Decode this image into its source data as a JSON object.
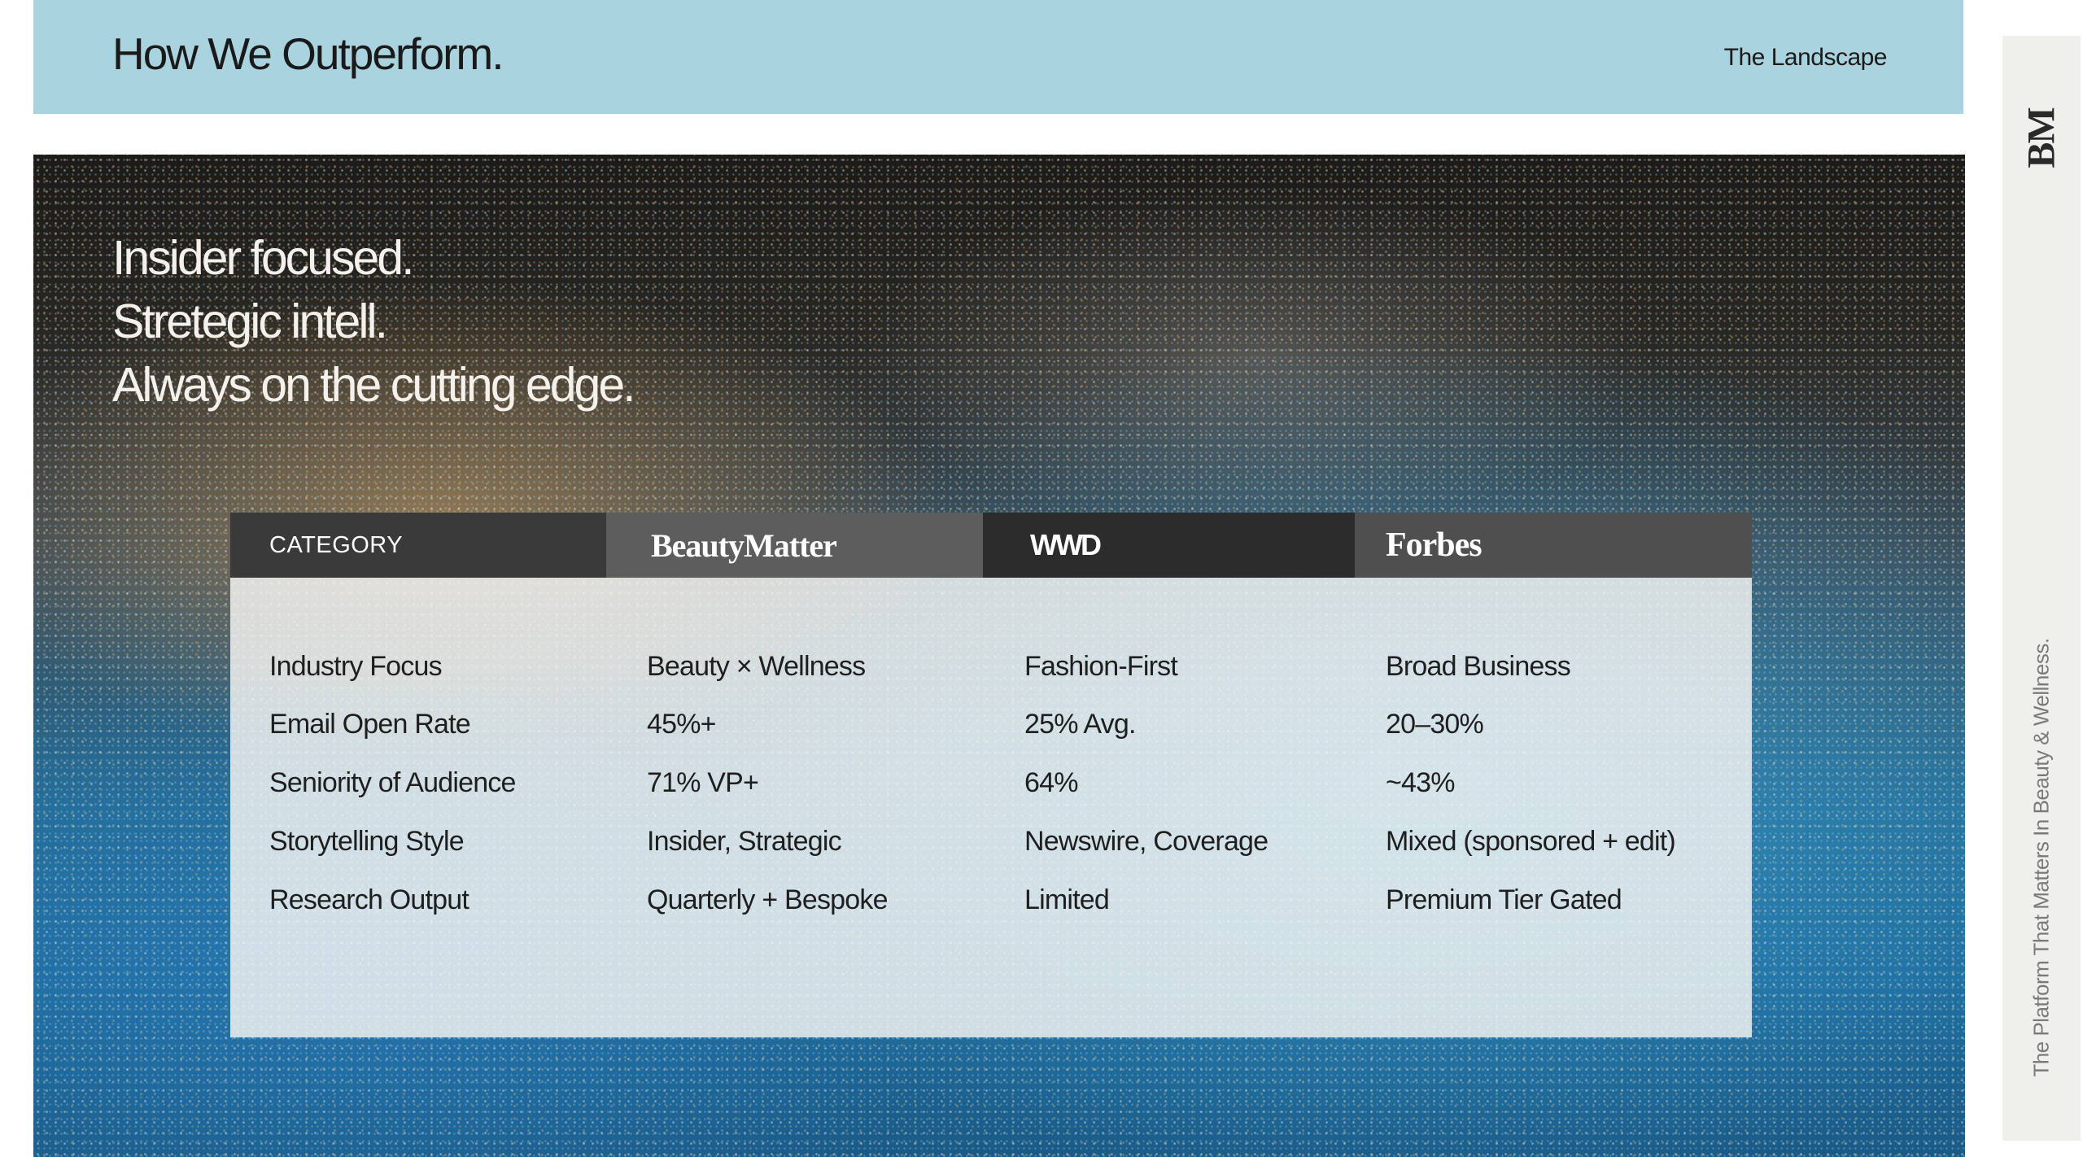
{
  "header": {
    "title": "How We Outperform.",
    "section": "The Landscape"
  },
  "hero": {
    "lines": [
      "Insider focused.",
      "Stretegic intell.",
      "Always on the cutting edge."
    ]
  },
  "table": {
    "headers": [
      "CATEGORY",
      "BeautyMatter",
      "WWD",
      "Forbes"
    ],
    "rows": [
      [
        "Industry Focus",
        "Beauty × Wellness",
        "Fashion-First",
        "Broad Business"
      ],
      [
        "Email Open Rate",
        "45%+",
        "25% Avg.",
        "20–30%"
      ],
      [
        "Seniority of Audience",
        "71% VP+",
        "64%",
        "~43%"
      ],
      [
        "Storytelling Style",
        "Insider, Strategic",
        "Newswire, Coverage",
        "Mixed (sponsored + edit)"
      ],
      [
        "Research Output",
        "Quarterly + Bespoke",
        "Limited",
        "Premium Tier Gated"
      ]
    ]
  },
  "sidebar": {
    "logo": "BM",
    "tagline": "The Platform That Matters In Beauty & Wellness."
  },
  "colors": {
    "header_bg": "#a9d3df",
    "table_head_dark": "#2c2c2c",
    "table_head_mid": "#5d5d5d",
    "side_tab_bg": "#efefec"
  }
}
